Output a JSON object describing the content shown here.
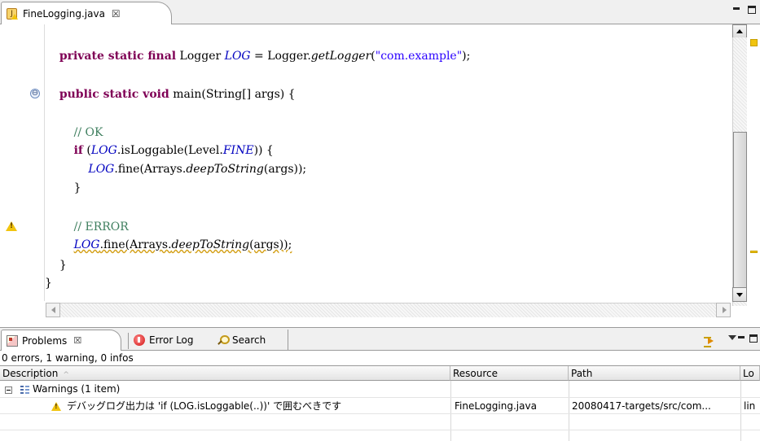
{
  "editor": {
    "tab_label": "FineLogging.java",
    "tab_close": "☒",
    "code": {
      "l1": {
        "indent": "    ",
        "kw": "private static final",
        "t1": " Logger ",
        "fld": "LOG",
        "t2": " = Logger.",
        "meth": "getLogger",
        "t3": "(",
        "str": "\"com.example\"",
        "t4": ");"
      },
      "l2": {
        "indent": "    ",
        "kw": "public static void",
        "t1": " main(String[] args) {"
      },
      "l3": {
        "indent": "        ",
        "cmt": "// OK"
      },
      "l4": {
        "indent": "        ",
        "kw": "if",
        "t1": " (",
        "fld": "LOG",
        "t2": ".isLoggable(Level.",
        "fld2": "FINE",
        "t3": ")) {"
      },
      "l5": {
        "indent": "            ",
        "fld": "LOG",
        "t1": ".fine(Arrays.",
        "meth": "deepToString",
        "t2": "(args));"
      },
      "l6": {
        "indent": "        ",
        "t1": "}"
      },
      "l7": {
        "indent": "        ",
        "cmt": "// ERROR"
      },
      "l8": {
        "indent": "        ",
        "fld": "LOG",
        "t1": ".fine(Arrays.",
        "meth": "deepToString",
        "t2": "(args));"
      },
      "l9": {
        "indent": "    ",
        "t1": "}"
      },
      "l10": {
        "t1": "}"
      }
    },
    "fold_symbol": "⊖"
  },
  "problems_view": {
    "tabs": [
      {
        "label": "Problems",
        "close": "☒"
      },
      {
        "label": "Error Log"
      },
      {
        "label": "Search"
      }
    ],
    "summary": "0 errors, 1 warning, 0 infos",
    "columns": [
      "Description",
      "Resource",
      "Path",
      "Lo"
    ],
    "sort_indicator": "^",
    "group": {
      "label": "Warnings (1 item)"
    },
    "rows": [
      {
        "description": "デバッグログ出力は 'if (LOG.isLoggable(..))' で囲むべきです",
        "resource": "FineLogging.java",
        "path": "20080417-targets/src/com...",
        "location": "lin"
      }
    ]
  },
  "colors": {
    "keyword": "#7f0055",
    "field": "#0000c0",
    "string": "#2a00ff",
    "comment": "#3f7f5f",
    "warning": "#f1c40f"
  },
  "icons": {
    "editor_tab": "java-file-warning-icon",
    "problems_tab": "problems-icon",
    "error_log_tab": "error-log-icon",
    "search_tab": "search-icon",
    "filter": "filter-icon",
    "group": "warnings-group-icon",
    "row": "warning-icon"
  }
}
